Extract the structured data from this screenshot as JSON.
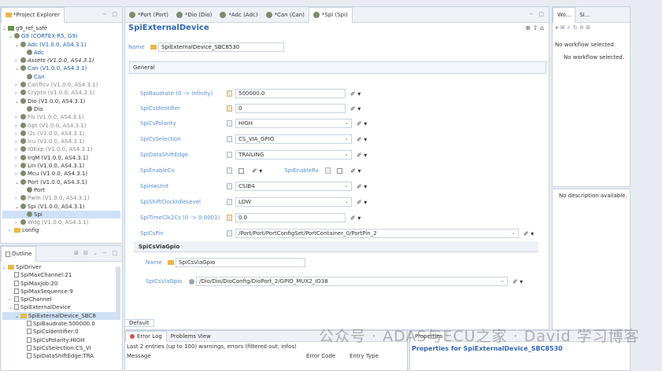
{
  "explorer": {
    "tab": "*Project Explorer",
    "tree": [
      {
        "label": "g9_ref_safe",
        "depth": 0,
        "arrow": "⌄",
        "kind": "proj",
        "style": ""
      },
      {
        "label": "G9 (CORTEX-R5, G9)",
        "depth": 1,
        "arrow": "⌄",
        "kind": "node",
        "style": "blue"
      },
      {
        "label": "Adc (V1.0.0, AS4.3.1)",
        "depth": 2,
        "arrow": "⌄",
        "kind": "node",
        "style": "blue"
      },
      {
        "label": "Adc",
        "depth": 3,
        "arrow": "",
        "kind": "node",
        "style": "blue"
      },
      {
        "label": "Assets (V1.0.0, AS4.3.1)",
        "depth": 2,
        "arrow": "›",
        "kind": "node",
        "style": "italic"
      },
      {
        "label": "Can (V1.0.0, AS4.3.1)",
        "depth": 2,
        "arrow": "⌄",
        "kind": "node",
        "style": "blue"
      },
      {
        "label": "Can",
        "depth": 3,
        "arrow": "",
        "kind": "node",
        "style": "blue"
      },
      {
        "label": "CanTrcv (V1.0.0, AS4.3.1)",
        "depth": 2,
        "arrow": "›",
        "kind": "node",
        "style": "gray"
      },
      {
        "label": "Crypto (V1.0.0, AS4.3.1)",
        "depth": 2,
        "arrow": "›",
        "kind": "node",
        "style": "gray"
      },
      {
        "label": "Dio (V1.0.0, AS4.3.1)",
        "depth": 2,
        "arrow": "⌄",
        "kind": "node",
        "style": ""
      },
      {
        "label": "Dio",
        "depth": 3,
        "arrow": "",
        "kind": "node",
        "style": ""
      },
      {
        "label": "Fls (V1.0.0, AS4.3.1)",
        "depth": 2,
        "arrow": "›",
        "kind": "node",
        "style": "gray"
      },
      {
        "label": "Gpt (V1.0.0, AS4.3.1)",
        "depth": 2,
        "arrow": "›",
        "kind": "node",
        "style": "gray"
      },
      {
        "label": "I2c (V1.0.0, AS4.3.1)",
        "depth": 2,
        "arrow": "›",
        "kind": "node",
        "style": "gray"
      },
      {
        "label": "Icu (V1.0.0, AS4.3.1)",
        "depth": 2,
        "arrow": "›",
        "kind": "node",
        "style": "gray"
      },
      {
        "label": "IOExp (V1.0.0, AS4.3.1)",
        "depth": 2,
        "arrow": "›",
        "kind": "node",
        "style": "gray"
      },
      {
        "label": "IrqM (V1.0.0, AS4.3.1)",
        "depth": 2,
        "arrow": "›",
        "kind": "node",
        "style": ""
      },
      {
        "label": "Lin (V1.0.0, AS4.3.1)",
        "depth": 2,
        "arrow": "›",
        "kind": "node",
        "style": ""
      },
      {
        "label": "Mcu (V1.0.0, AS4.3.1)",
        "depth": 2,
        "arrow": "›",
        "kind": "node",
        "style": ""
      },
      {
        "label": "Port (V1.0.0, AS4.3.1)",
        "depth": 2,
        "arrow": "⌄",
        "kind": "node",
        "style": ""
      },
      {
        "label": "Port",
        "depth": 3,
        "arrow": "",
        "kind": "node",
        "style": ""
      },
      {
        "label": "Pwm (V1.0.0, AS4.3.1)",
        "depth": 2,
        "arrow": "›",
        "kind": "node",
        "style": "gray"
      },
      {
        "label": "Spi (V1.0.0, AS4.3.1)",
        "depth": 2,
        "arrow": "⌄",
        "kind": "node",
        "style": ""
      },
      {
        "label": "Spi",
        "depth": 3,
        "arrow": "",
        "kind": "node",
        "style": "sel"
      },
      {
        "label": "Wdg (V1.0.0, AS4.3.1)",
        "depth": 2,
        "arrow": "›",
        "kind": "node",
        "style": "gray"
      },
      {
        "label": "config",
        "depth": 1,
        "arrow": "›",
        "kind": "folder",
        "style": ""
      }
    ]
  },
  "outline": {
    "tab": "Outline",
    "tree": [
      {
        "label": "SpiDriver",
        "depth": 0,
        "arrow": "⌄",
        "kind": "folder",
        "style": ""
      },
      {
        "label": "SpiMaxChannel:21",
        "depth": 1,
        "arrow": "",
        "kind": "leaf",
        "style": ""
      },
      {
        "label": "SpiMaxJob:20",
        "depth": 1,
        "arrow": "",
        "kind": "leaf",
        "style": ""
      },
      {
        "label": "SpiMaxSequence:9",
        "depth": 1,
        "arrow": "",
        "kind": "leaf",
        "style": ""
      },
      {
        "label": "SpiChannel",
        "depth": 1,
        "arrow": "›",
        "kind": "leaf",
        "style": ""
      },
      {
        "label": "SpiExternalDevice",
        "depth": 1,
        "arrow": "⌄",
        "kind": "leaf",
        "style": ""
      },
      {
        "label": "SpiExternalDevice_SBC8",
        "depth": 2,
        "arrow": "⌄",
        "kind": "folder",
        "style": "sel"
      },
      {
        "label": "SpiBaudrate:500000.0",
        "depth": 3,
        "arrow": "",
        "kind": "leaf",
        "style": ""
      },
      {
        "label": "SpiCsIdentifier:0",
        "depth": 3,
        "arrow": "",
        "kind": "leaf",
        "style": ""
      },
      {
        "label": "SpiCsPolarity:HIGH",
        "depth": 3,
        "arrow": "",
        "kind": "leaf",
        "style": ""
      },
      {
        "label": "SpiCsSelection:CS_Vi",
        "depth": 3,
        "arrow": "",
        "kind": "leaf",
        "style": ""
      },
      {
        "label": "SpiDataShiftEdge:TRA",
        "depth": 3,
        "arrow": "",
        "kind": "leaf",
        "style": ""
      }
    ]
  },
  "editor_tabs": [
    "*Port (Port)",
    "*Dio (Dio)",
    "*Adc (Adc)",
    "*Can (Can)",
    "*Spi (Spi)"
  ],
  "editor": {
    "title": "SpiExternalDevice",
    "name_label": "Name",
    "name_value": "SpiExternalDevice_SBC8530",
    "group": "General",
    "params": [
      {
        "label": "SpiBaudrate (0 -> Infinity)",
        "value": "500000.0",
        "num": true,
        "dd": false,
        "width": 140
      },
      {
        "label": "SpiCsIdentifier",
        "value": "0",
        "num": true,
        "dd": false,
        "width": 140
      },
      {
        "label": "SpiCsPolarity",
        "value": "HIGH",
        "num": false,
        "dd": true,
        "width": 148
      },
      {
        "label": "SpiCsSelection",
        "value": "CS_VIA_GPIO",
        "num": false,
        "dd": true,
        "width": 148
      },
      {
        "label": "SpiDataShiftEdge",
        "value": "TRAILING",
        "num": false,
        "dd": true,
        "width": 148
      },
      {
        "label": "SpiEnableCs",
        "value": "",
        "num": false,
        "dd": false,
        "width": 0
      },
      {
        "label": "SpiHwUnit",
        "value": "CSIB4",
        "num": false,
        "dd": true,
        "width": 148
      },
      {
        "label": "SpiShiftClockIdleLevel",
        "value": "LOW",
        "num": false,
        "dd": true,
        "width": 148
      },
      {
        "label": "SpiTimeClk2Cs (0 -> 0.0001)",
        "value": "0.0",
        "num": true,
        "dd": false,
        "width": 140
      },
      {
        "label": "SpiCsPin",
        "value": "/Port/Port/PortConfigSet/PortContainer_0/PortPin_2",
        "num": false,
        "dd": true,
        "width": 360
      }
    ],
    "enable_rx_label": "SpiEnableRx",
    "sub": {
      "title": "SpiCsViaGpio",
      "name_label": "Name",
      "name_value": "SpiCsViaGpio",
      "field_label": "SpiCsViaGpio",
      "field_value": "/Dio/Dio/DioConfig/DioPort_2/GPIO_MUX2_IO38"
    },
    "default_tab": "Default"
  },
  "workflow": {
    "tab1": "Wo...",
    "tab2": "Si...",
    "msg1": "No workflow selected.",
    "msg2": "No workflow selected.",
    "desc": "No description available."
  },
  "bottom": {
    "error_log": "Error Log",
    "problems": "Problems View",
    "entries": "Last 2 entries (up to 100) warnings, errors (filtered out: infos)",
    "col1": "Message",
    "col2": "Error Code",
    "col3": "Entry Type",
    "properties": "Properties",
    "properties_title": "Properties for SpiExternalDevice_SBC8530"
  },
  "watermark": "公众号 · ADAS与ECU之家 · David 学习博客"
}
